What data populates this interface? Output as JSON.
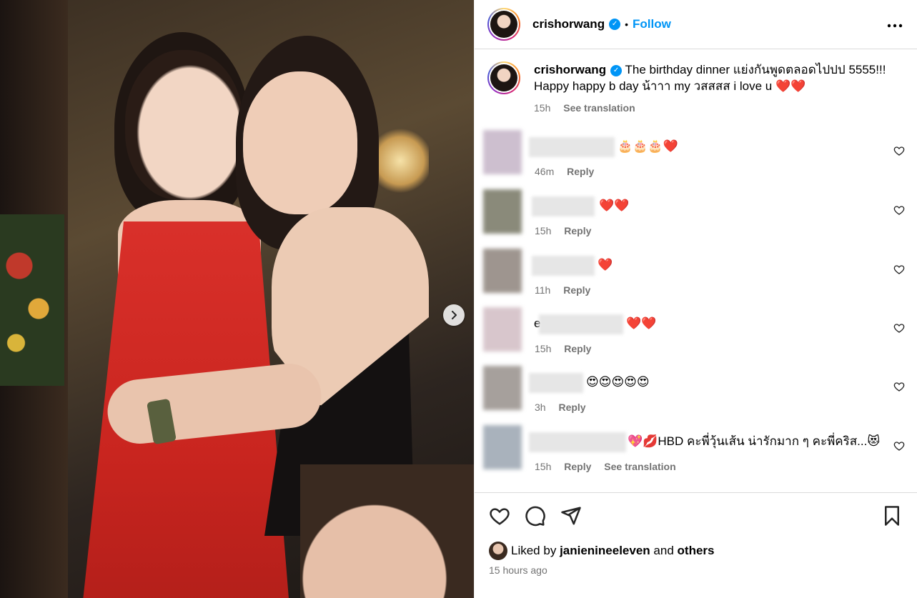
{
  "post": {
    "username": "crishorwang",
    "follow_label": "Follow",
    "dot": "•",
    "more_label": "•••"
  },
  "caption": {
    "username": "crishorwang",
    "text": "The birthday dinner แย่งกันพูดตลอดไปปป 5555!!! Happy happy b day น้าาา my วสสสส i love u ❤️❤️",
    "time": "15h",
    "translate_label": "See translation"
  },
  "comments": [
    {
      "text": "🎂🎂🎂❤️",
      "time": "46m",
      "reply_label": "Reply"
    },
    {
      "text": "❤️❤️",
      "time": "15h",
      "reply_label": "Reply"
    },
    {
      "text": "❤️",
      "time": "11h",
      "reply_label": "Reply"
    },
    {
      "text": "❤️❤️",
      "prefix": "e",
      "time": "15h",
      "reply_label": "Reply"
    },
    {
      "text": "😍😍😍😍😍",
      "time": "3h",
      "reply_label": "Reply"
    },
    {
      "text": "💖💋HBD คะพี่วุ้นเส้น น่ารักมาก ๆ คะพี่คริส...😻",
      "time": "15h",
      "reply_label": "Reply",
      "translate_label": "See translation"
    }
  ],
  "liked": {
    "prefix": "Liked by",
    "user": "janienineeleven",
    "conj": "and",
    "others": "others"
  },
  "posted_ago": "15 hours ago",
  "icons": {
    "like": "heart-icon",
    "comment": "comment-icon",
    "share": "share-icon",
    "save": "bookmark-icon",
    "next": "chevron-right-icon"
  },
  "colors": {
    "accent": "#0095f6",
    "muted": "#737373",
    "border": "#dbdbdb"
  }
}
